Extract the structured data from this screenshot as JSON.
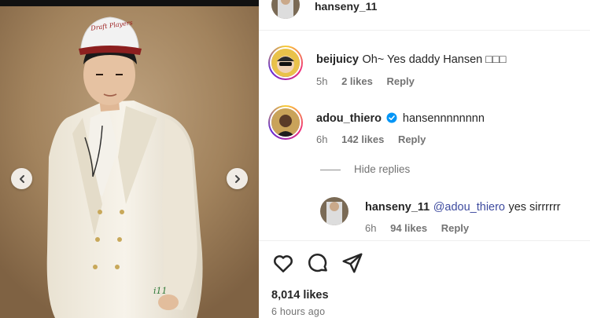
{
  "post": {
    "owner": "hanseny_11",
    "likes": "8,014 likes",
    "time": "6 hours ago",
    "cap_logo": "Draft Players"
  },
  "comments": [
    {
      "user": "beijuicy",
      "text": "Oh~ Yes daddy Hansen □□□",
      "time": "5h",
      "likes": "2 likes",
      "reply": "Reply",
      "verified": false
    },
    {
      "user": "adou_thiero",
      "text": "hansennnnnnnn",
      "time": "6h",
      "likes": "142 likes",
      "reply": "Reply",
      "verified": true
    }
  ],
  "hide_replies": "Hide replies",
  "reply": {
    "user": "hanseny_11",
    "mention": "@adou_thiero",
    "text": "yes sirrrrrr",
    "time": "6h",
    "likes": "94 likes",
    "reply": "Reply"
  },
  "jacket_text": "i11",
  "icons": {
    "like": "heart-icon",
    "comment": "comment-icon",
    "share": "share-icon",
    "prev": "chevron-left-icon",
    "next": "chevron-right-icon"
  },
  "colors": {
    "mention": "#3e4b9f",
    "verified": "#0095f6",
    "muted": "#737373"
  }
}
